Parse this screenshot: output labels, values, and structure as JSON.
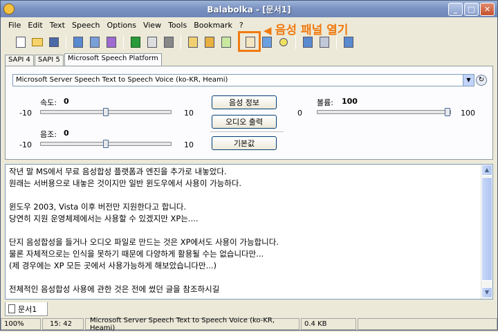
{
  "window": {
    "title": "Balabolka - [문서1]"
  },
  "menu": [
    "File",
    "Edit",
    "Text",
    "Speech",
    "Options",
    "View",
    "Tools",
    "Bookmark",
    "?"
  ],
  "annotation": {
    "text": "음성 패널 열기",
    "color": "#f07a10"
  },
  "tabs": [
    "SAPI 4",
    "SAPI 5",
    "Microsoft Speech Platform"
  ],
  "panel": {
    "voice": "Microsoft Server Speech Text to Speech Voice (ko-KR, Heami)",
    "rate": {
      "label": "속도:",
      "value": "0",
      "min": "-10",
      "max": "10",
      "level": 0.5
    },
    "pitch": {
      "label": "음조:",
      "value": "0",
      "min": "-10",
      "max": "10",
      "level": 0.5
    },
    "volume": {
      "label": "볼륨:",
      "value": "100",
      "min": "0",
      "max": "100",
      "level": 1.0
    },
    "buttons": {
      "voice_info": "음성 정보",
      "audio_output": "오디오 출력",
      "defaults": "기본값"
    }
  },
  "editor": {
    "lines": [
      "작년 말 MS에서 무료 음성합성 플랫폼과 엔진을 추가로 내놓았다.",
      "원래는 서버용으로 내놓은 것이지만 일반 윈도우에서 사용이 가능하다.",
      "",
      "윈도우 2003, Vista 이후 버전만 지원한다고 합니다.",
      "당연히 지원 운영체제에서는 사용할 수 있겠지만 XP는....",
      "",
      "단지 음성합성을 들거나 오디오 파일로 만드는 것은 XP에서도 사용이 가능합니다.",
      "물론 자체적으로는 인식을 못하기 때문에 다양하게 활용될 수는 없습니다만...",
      "(제 경우에는 XP 모든 곳에서 사용가능하게 해보았습니다만...)",
      "",
      "전체적인 음성합성 사용에 관한 것은 전에 썼던 글을 참조하시길",
      ""
    ]
  },
  "document_tab": "문서1",
  "status": {
    "zoom": "100%",
    "position": "15:  42",
    "voice": "Microsoft Server Speech Text to Speech Voice (ko-KR, Heami)",
    "size": "0.4 KB"
  }
}
